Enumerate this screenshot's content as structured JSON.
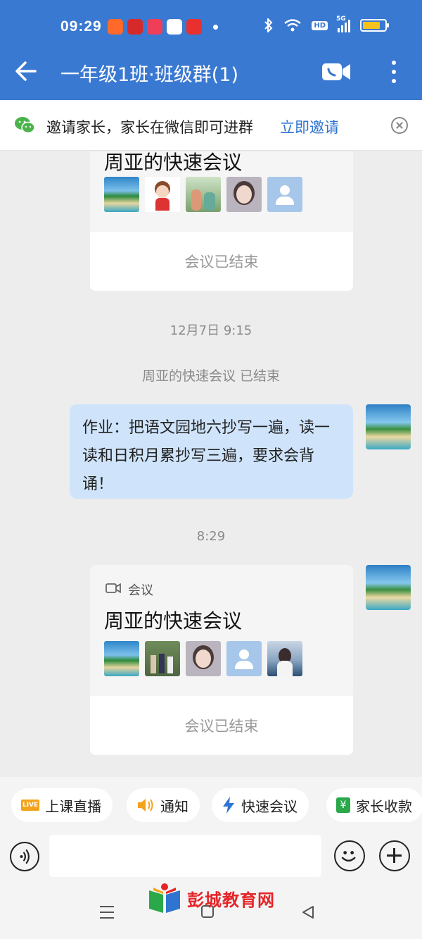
{
  "status_bar": {
    "time": "09:29",
    "network": "5G",
    "hd": "HD"
  },
  "header": {
    "title": "一年级1班·班级群(1)"
  },
  "invite": {
    "text": "邀请家长，家长在微信即可进群",
    "link": "立即邀请"
  },
  "meeting_card_1": {
    "title": "周亚的快速会议",
    "footer": "会议已结束"
  },
  "timestamp_1": "12月7日  9:15",
  "system_message": "周亚的快速会议 已结束",
  "homework_message": "作业：把语文园地六抄写一遍，读一读和日积月累抄写三遍，要求会背诵！",
  "timestamp_2": "8:29",
  "meeting_card_2": {
    "label": "会议",
    "title": "周亚的快速会议",
    "footer": "会议已结束"
  },
  "quick_actions": [
    {
      "label": "上课直播",
      "icon": "live-icon"
    },
    {
      "label": "通知",
      "icon": "speaker-icon"
    },
    {
      "label": "快速会议",
      "icon": "lightning-icon"
    },
    {
      "label": "家长收款",
      "icon": "yuan-icon"
    }
  ],
  "watermark": "彭城教育网",
  "colors": {
    "header": "#3a79d1",
    "link": "#2f74d0",
    "bubble": "#cfe4fb",
    "watermark": "#e52428"
  }
}
